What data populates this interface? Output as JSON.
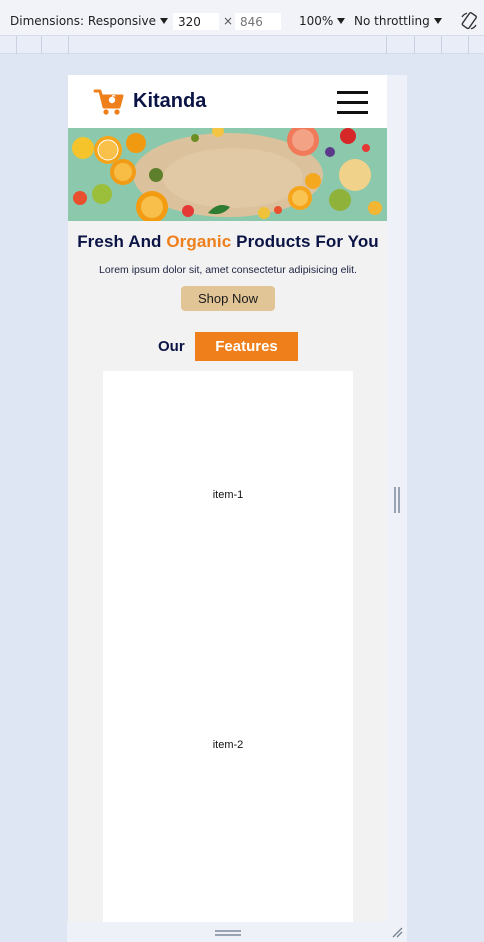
{
  "devtools": {
    "dimensions_label": "Dimensions: Responsive",
    "width_value": "320",
    "height_placeholder": "846",
    "times": "×",
    "zoom_label": "100%",
    "throttle_label": "No throttling"
  },
  "site": {
    "brand": "Kitanda",
    "headline": {
      "part1": "Fresh And ",
      "accent": "Organic",
      "part2": " Products For You"
    },
    "subtext": "Lorem ipsum dolor sit, amet consectetur adipisicing elit.",
    "shop_button": "Shop Now",
    "features": {
      "prefix": "Our",
      "badge": "Features"
    },
    "items": [
      "item-1",
      "item-2"
    ]
  },
  "colors": {
    "accent": "#ef7f1a",
    "navy": "#0b1445",
    "button": "#e2c596"
  }
}
